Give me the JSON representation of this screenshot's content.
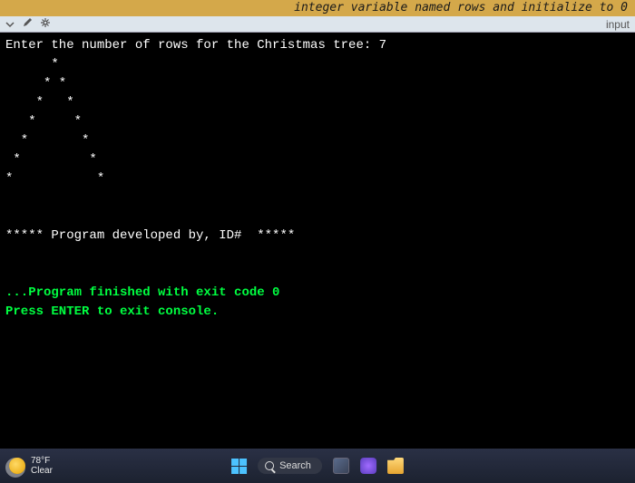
{
  "top_banner_text": "integer variable named rows and initialize to 0",
  "subbar": {
    "right_label": "input"
  },
  "console": {
    "line1": "Enter the number of rows for the Christmas tree: 7",
    "tree_rows": [
      "      *",
      "     * *",
      "    *   *",
      "   *     *",
      "  *       *",
      " *         *",
      "*           *"
    ],
    "blank": "",
    "developed_by": "***** Program developed by, ID#  *****",
    "finished": "...Program finished with exit code 0",
    "press_enter": "Press ENTER to exit console."
  },
  "taskbar": {
    "temp": "78°F",
    "condition": "Clear",
    "search_label": "Search"
  }
}
